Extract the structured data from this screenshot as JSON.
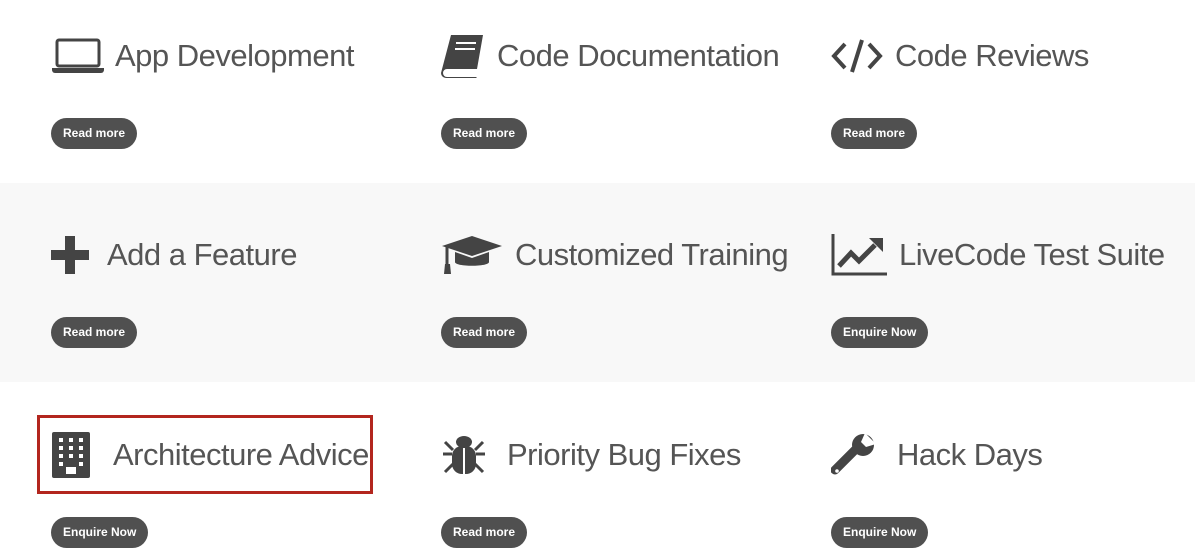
{
  "cards": [
    {
      "title": "App Development",
      "button": "Read more",
      "icon": "laptop-icon"
    },
    {
      "title": "Code Documentation",
      "button": "Read more",
      "icon": "book-icon"
    },
    {
      "title": "Code Reviews",
      "button": "Read more",
      "icon": "code-icon"
    },
    {
      "title": "Add a Feature",
      "button": "Read more",
      "icon": "plus-icon"
    },
    {
      "title": "Customized Training",
      "button": "Read more",
      "icon": "graduation-cap-icon"
    },
    {
      "title": "LiveCode Test Suite",
      "button": "Enquire Now",
      "icon": "line-chart-icon"
    },
    {
      "title": "Architecture Advice",
      "button": "Enquire Now",
      "icon": "building-icon"
    },
    {
      "title": "Priority Bug Fixes",
      "button": "Read more",
      "icon": "bug-icon"
    },
    {
      "title": "Hack Days",
      "button": "Enquire Now",
      "icon": "wrench-icon"
    }
  ],
  "colors": {
    "highlight": "#b3261e",
    "button": "#505050",
    "band": "#f8f8f8"
  }
}
